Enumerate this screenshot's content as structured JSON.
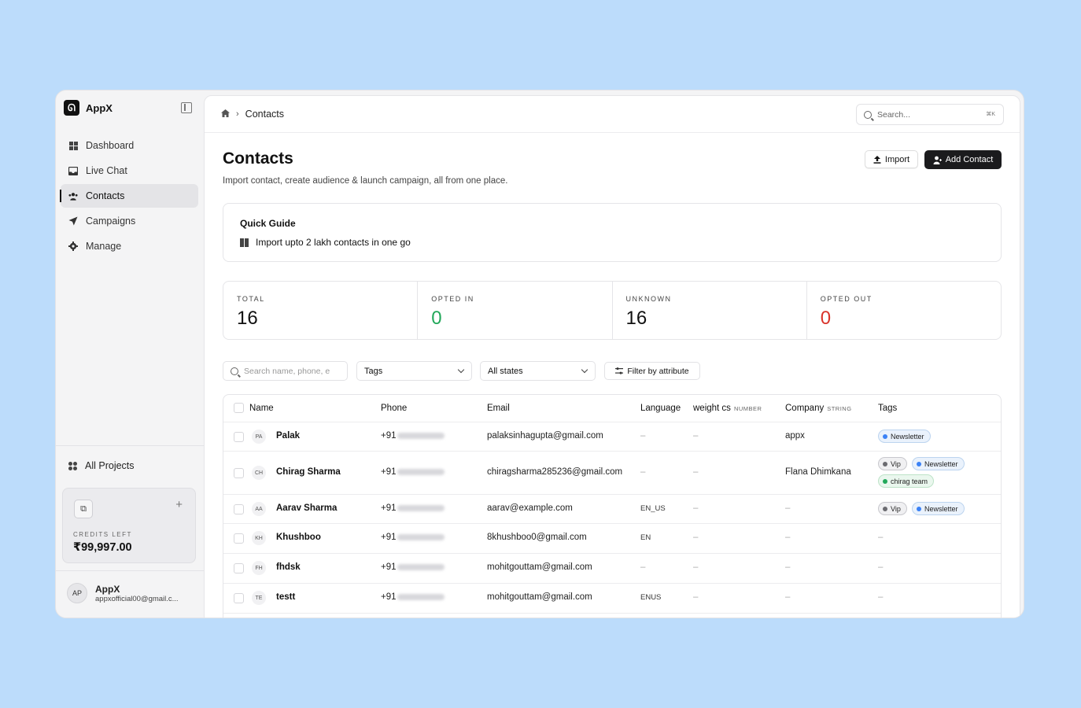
{
  "app": {
    "name": "AppX",
    "logo_letter": "ᘏ"
  },
  "sidebar": {
    "items": [
      {
        "label": "Dashboard",
        "icon": "dashboard-icon"
      },
      {
        "label": "Live Chat",
        "icon": "inbox-icon"
      },
      {
        "label": "Contacts",
        "icon": "users-icon",
        "active": true
      },
      {
        "label": "Campaigns",
        "icon": "send-icon"
      },
      {
        "label": "Manage",
        "icon": "gear-icon"
      }
    ],
    "projects_label": "All Projects",
    "credits_label": "CREDITS LEFT",
    "credits_value": "₹99,997.00",
    "user": {
      "initials": "AP",
      "name": "AppX",
      "email": "appxofficial00@gmail.c..."
    }
  },
  "topbar": {
    "breadcrumb": "Contacts",
    "search_placeholder": "Search...",
    "search_shortcut": "⌘K"
  },
  "page": {
    "title": "Contacts",
    "subtitle": "Import contact, create audience & launch campaign, all from one place.",
    "import_label": "Import",
    "add_label": "Add Contact"
  },
  "guide": {
    "title": "Quick Guide",
    "item": "Import upto 2 lakh contacts in one go"
  },
  "stats": [
    {
      "label": "TOTAL",
      "value": "16",
      "color": "#111111"
    },
    {
      "label": "OPTED IN",
      "value": "0",
      "color": "#22a85a"
    },
    {
      "label": "UNKNOWN",
      "value": "16",
      "color": "#111111"
    },
    {
      "label": "OPTED OUT",
      "value": "0",
      "color": "#d9342b"
    }
  ],
  "filters": {
    "search_placeholder": "Search name, phone, e",
    "tags_label": "Tags",
    "states_label": "All states",
    "attribute_label": "Filter by attribute"
  },
  "table": {
    "headers": {
      "name": "Name",
      "phone": "Phone",
      "email": "Email",
      "language": "Language",
      "weight": "weight cs",
      "weight_type": "NUMBER",
      "company": "Company",
      "company_type": "STRING",
      "tags": "Tags"
    },
    "rows": [
      {
        "initials": "PA",
        "name": "Palak",
        "phone_prefix": "+91",
        "email": "palaksinhagupta@gmail.com",
        "language": "–",
        "weight": "–",
        "company": "appx",
        "tags": [
          {
            "label": "Newsletter",
            "color": "#3b82f6"
          }
        ]
      },
      {
        "initials": "CH",
        "name": "Chirag Sharma",
        "phone_prefix": "+91",
        "email": "chiragsharma285236@gmail.com",
        "language": "–",
        "weight": "–",
        "company": "Flana Dhimkana",
        "tags": [
          {
            "label": "Vip",
            "color": "#6b6b70"
          },
          {
            "label": "Newsletter",
            "color": "#3b82f6"
          },
          {
            "label": "chirag team",
            "color": "#22a85a"
          }
        ]
      },
      {
        "initials": "AA",
        "name": "Aarav Sharma",
        "phone_prefix": "+91",
        "email": "aarav@example.com",
        "language": "EN_US",
        "weight": "–",
        "company": "–",
        "tags": [
          {
            "label": "Vip",
            "color": "#6b6b70"
          },
          {
            "label": "Newsletter",
            "color": "#3b82f6"
          }
        ]
      },
      {
        "initials": "KH",
        "name": "Khushboo",
        "phone_prefix": "+91",
        "email": "8khushboo0@gmail.com",
        "language": "EN",
        "weight": "–",
        "company": "–",
        "tags": []
      },
      {
        "initials": "FH",
        "name": "fhdsk",
        "phone_prefix": "+91",
        "email": "mohitgouttam@gmail.com",
        "language": "–",
        "weight": "–",
        "company": "–",
        "tags": []
      },
      {
        "initials": "TE",
        "name": "testt",
        "phone_prefix": "+91",
        "email": "mohitgouttam@gmail.com",
        "language": "ENUS",
        "weight": "–",
        "company": "–",
        "tags": []
      }
    ]
  }
}
